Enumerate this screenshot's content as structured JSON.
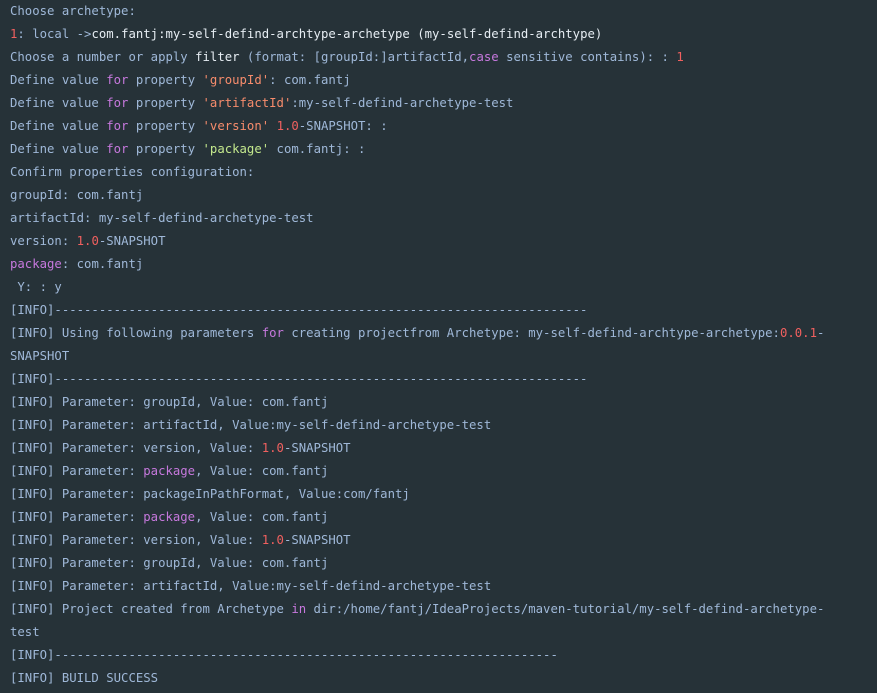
{
  "terminal": {
    "lines": [
      [
        [
          "p",
          "Choose archetype:"
        ]
      ],
      [
        [
          "r",
          "1"
        ],
        [
          "p",
          ": local ->"
        ],
        [
          "w",
          "com.fantj:my-self-defind-archtype-archetype (my-self-defind-archtype)"
        ]
      ],
      [
        [
          "p",
          "Choose a number "
        ],
        [
          "p",
          "or"
        ],
        [
          "p",
          " apply "
        ],
        [
          "w",
          "filter"
        ],
        [
          "p",
          " (format: ["
        ],
        [
          "p",
          "groupId:"
        ],
        [
          "p",
          "]artifactId,"
        ],
        [
          "k",
          "case"
        ],
        [
          "p",
          " sensitive contains): : "
        ],
        [
          "r",
          "1"
        ]
      ],
      [
        [
          "p",
          "Define value "
        ],
        [
          "k",
          "for"
        ],
        [
          "p",
          " property "
        ],
        [
          "o",
          "'groupId'"
        ],
        [
          "p",
          ": "
        ],
        [
          "p",
          "com.fantj"
        ]
      ],
      [
        [
          "p",
          "Define value "
        ],
        [
          "k",
          "for"
        ],
        [
          "p",
          " property "
        ],
        [
          "o",
          "'artifactId'"
        ],
        [
          "p",
          ":my-self-defind-archetype-test"
        ]
      ],
      [
        [
          "p",
          "Define value "
        ],
        [
          "k",
          "for"
        ],
        [
          "p",
          " property "
        ],
        [
          "o",
          "'version'"
        ],
        [
          "p",
          " "
        ],
        [
          "r",
          "1.0"
        ],
        [
          "p",
          "-SNAPSHOT: :"
        ]
      ],
      [
        [
          "p",
          "Define value "
        ],
        [
          "k",
          "for"
        ],
        [
          "p",
          " property "
        ],
        [
          "s",
          "'package'"
        ],
        [
          "p",
          " com.fantj: :"
        ]
      ],
      [
        [
          "p",
          "Confirm properties configuration:"
        ]
      ],
      [
        [
          "p",
          "groupId: com.fantj"
        ]
      ],
      [
        [
          "p",
          "artifactId: my-self-defind-archetype-test"
        ]
      ],
      [
        [
          "p",
          "version: "
        ],
        [
          "r",
          "1.0"
        ],
        [
          "p",
          "-SNAPSHOT"
        ]
      ],
      [
        [
          "k",
          "package"
        ],
        [
          "p",
          ": com.fantj"
        ]
      ],
      [
        [
          "p",
          " Y: : y"
        ]
      ],
      [
        [
          "p",
          "[INFO]------------------------------------------------------------------------"
        ]
      ],
      [
        [
          "p",
          "[INFO] Using following parameters "
        ],
        [
          "k",
          "for"
        ],
        [
          "p",
          " creating projectfrom Archetype: my-self-defind-archtype-archetype:"
        ],
        [
          "r",
          "0.0.1"
        ],
        [
          "p",
          "-"
        ]
      ],
      [
        [
          "p",
          "SNAPSHOT"
        ]
      ],
      [
        [
          "p",
          "[INFO]------------------------------------------------------------------------"
        ]
      ],
      [
        [
          "p",
          "[INFO] Parameter: groupId, Value: com.fantj"
        ]
      ],
      [
        [
          "p",
          "[INFO] Parameter: artifactId, Value:my-self-defind-archetype-test"
        ]
      ],
      [
        [
          "p",
          "[INFO] Parameter: version, Value: "
        ],
        [
          "r",
          "1.0"
        ],
        [
          "p",
          "-SNAPSHOT"
        ]
      ],
      [
        [
          "p",
          "[INFO] Parameter: "
        ],
        [
          "k",
          "package"
        ],
        [
          "p",
          ", Value: com.fantj"
        ]
      ],
      [
        [
          "p",
          "[INFO] Parameter: packageInPathFormat, Value:com/fantj"
        ]
      ],
      [
        [
          "p",
          "[INFO] Parameter: "
        ],
        [
          "k",
          "package"
        ],
        [
          "p",
          ", Value: com.fantj"
        ]
      ],
      [
        [
          "p",
          "[INFO] Parameter: version, Value: "
        ],
        [
          "r",
          "1.0"
        ],
        [
          "p",
          "-SNAPSHOT"
        ]
      ],
      [
        [
          "p",
          "[INFO] Parameter: groupId, Value: com.fantj"
        ]
      ],
      [
        [
          "p",
          "[INFO] Parameter: artifactId, Value:my-self-defind-archetype-test"
        ]
      ],
      [
        [
          "p",
          "[INFO] Project created from Archetype "
        ],
        [
          "k",
          "in"
        ],
        [
          "p",
          " dir:/home/fantj/IdeaProjects/maven-tutorial/my-self-defind-archetype-"
        ]
      ],
      [
        [
          "p",
          "test"
        ]
      ],
      [
        [
          "p",
          "[INFO]--------------------------------------------------------------------"
        ]
      ],
      [
        [
          "p",
          "[INFO] BUILD SUCCESS"
        ]
      ]
    ]
  }
}
